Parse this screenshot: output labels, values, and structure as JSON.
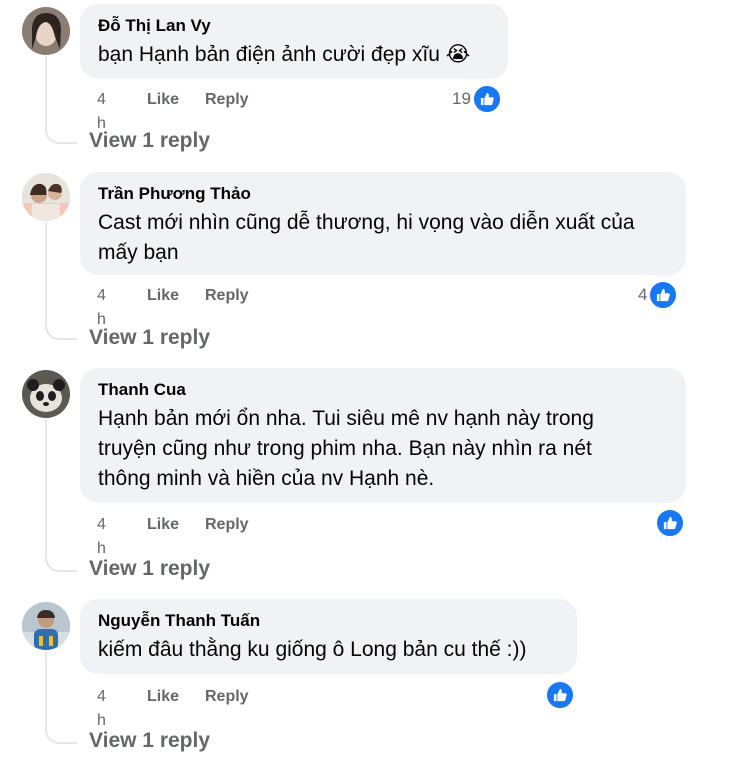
{
  "comments": [
    {
      "author": "Đỗ Thị Lan Vy",
      "text_lines": [
        "bạn Hạnh bản điện ảnh cười đẹp xĩu 😭"
      ],
      "time": "4 h",
      "like_label": "Like",
      "reply_label": "Reply",
      "reaction_count": "19",
      "view_replies": "View 1 reply"
    },
    {
      "author": "Trần Phương Thảo",
      "text_lines": [
        "Cast mới nhìn cũng dễ thương, hi vọng vào diễn xuất của",
        "mấy bạn"
      ],
      "time": "4 h",
      "like_label": "Like",
      "reply_label": "Reply",
      "reaction_count": "4",
      "view_replies": "View 1 reply"
    },
    {
      "author": "Thanh Cua",
      "text_lines": [
        "Hạnh bản mới ổn nha. Tui siêu mê nv hạnh này trong",
        "truyện cũng như trong phim nha. Bạn này nhìn ra nét",
        "thông minh và hiền của nv Hạnh nè."
      ],
      "time": "4 h",
      "like_label": "Like",
      "reply_label": "Reply",
      "reaction_count": "",
      "view_replies": "View 1 reply"
    },
    {
      "author": "Nguyễn Thanh Tuấn",
      "text_lines": [
        "kiếm đâu thằng ku giống ô Long bản cu thế :))"
      ],
      "time": "4 h",
      "like_label": "Like",
      "reply_label": "Reply",
      "reaction_count": "",
      "view_replies": "View 1 reply"
    }
  ],
  "icons": {
    "reaction": "like-icon"
  },
  "colors": {
    "accent": "#1877f2",
    "bubble": "#f0f2f5",
    "muted": "#65676b"
  }
}
